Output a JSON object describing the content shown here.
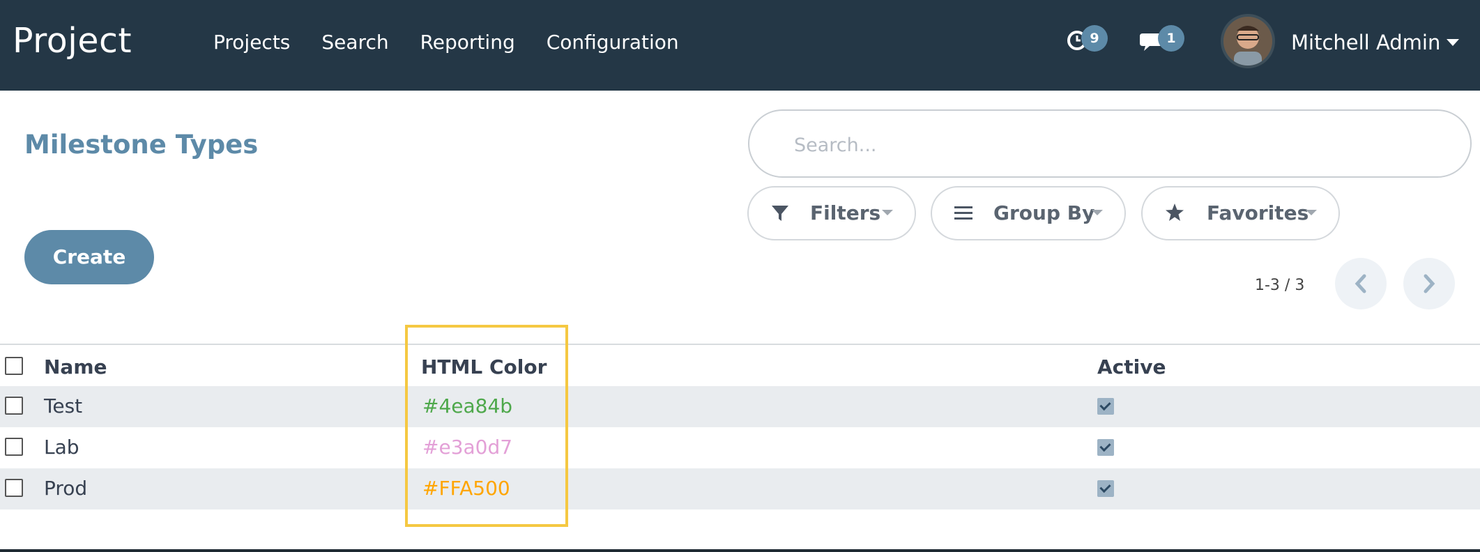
{
  "nav": {
    "brand": "Project",
    "menu": [
      "Projects",
      "Search",
      "Reporting",
      "Configuration"
    ],
    "activity_count": "9",
    "message_count": "1",
    "user_name": "Mitchell Admin"
  },
  "page": {
    "title": "Milestone Types",
    "create_label": "Create",
    "search_placeholder": "Search...",
    "filters_label": "Filters",
    "groupby_label": "Group By",
    "favorites_label": "Favorites",
    "pager": "1-3 / 3"
  },
  "table": {
    "headers": {
      "name": "Name",
      "color": "HTML Color",
      "active": "Active"
    },
    "rows": [
      {
        "name": "Test",
        "color": "#4ea84b",
        "text_color": "#4ea84b",
        "active": true
      },
      {
        "name": "Lab",
        "color": "#e3a0d7",
        "text_color": "#e3a0d7",
        "active": true
      },
      {
        "name": "Prod",
        "color": "#FFA500",
        "text_color": "#FFA500",
        "active": true
      }
    ]
  },
  "colors": {
    "navbar": "#243746",
    "accent": "#5d8aa8",
    "highlight": "#f5c842",
    "stripe": "#e9ecef"
  }
}
